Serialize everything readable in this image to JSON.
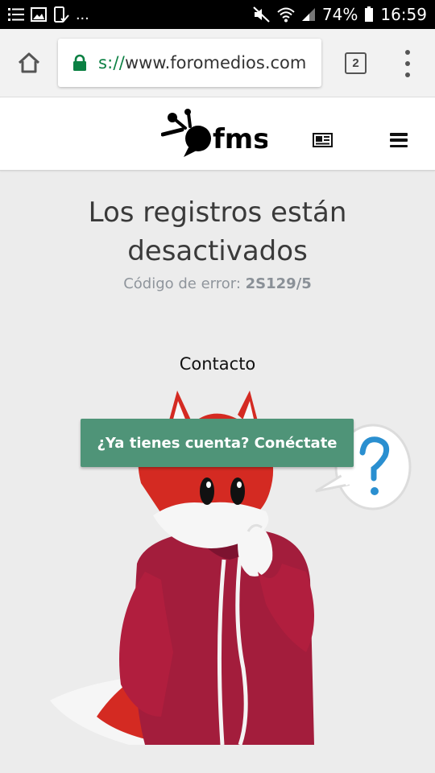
{
  "status_bar": {
    "more": "...",
    "battery": "74%",
    "time": "16:59"
  },
  "browser": {
    "url_scheme": "s://",
    "url_host": "www.foromedios.com",
    "tab_count": "2"
  },
  "header": {
    "logo_text": "fms"
  },
  "main": {
    "title": "Los registros están desactivados",
    "error_label": "Código de error:",
    "error_code": "2S129/5",
    "contact": "Contacto",
    "login_button": "¿Ya tienes cuenta? Conéctate"
  },
  "colors": {
    "button": "#4f9478",
    "fox_red": "#d42a22",
    "fox_jacket": "#a31d3c",
    "speech_question": "#2a8fd0"
  },
  "icons": [
    "list-icon",
    "image-icon",
    "phone-check-icon",
    "mute-icon",
    "wifi-icon",
    "signal-icon",
    "battery-icon",
    "home-icon",
    "lock-icon",
    "menu-dots-icon",
    "news-icon",
    "hamburger-icon"
  ]
}
